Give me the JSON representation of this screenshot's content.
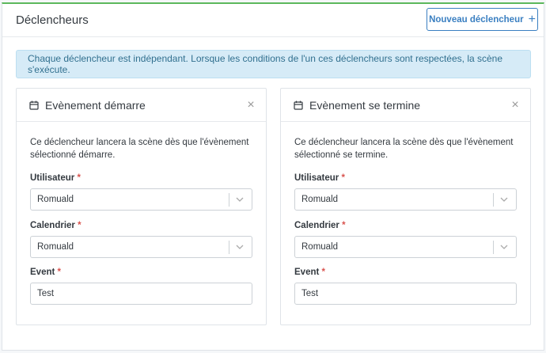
{
  "panel": {
    "title": "Déclencheurs",
    "new_button_label": "Nouveau déclencheur",
    "plus_glyph": "+",
    "info": "Chaque déclencheur est indépendant. Lorsque les conditions de l'un ces déclencheurs sont respectées, la scène s'exécute."
  },
  "cards": [
    {
      "title": "Evènement démarre",
      "description": "Ce déclencheur lancera la scène dès que l'évènement sélectionné démarre.",
      "user_label": "Utilisateur",
      "user_value": "Romuald",
      "calendar_label": "Calendrier",
      "calendar_value": "Romuald",
      "event_label": "Event",
      "event_value": "Test"
    },
    {
      "title": "Evènement se termine",
      "description": "Ce déclencheur lancera la scène dès que l'évènement sélectionné se termine.",
      "user_label": "Utilisateur",
      "user_value": "Romuald",
      "calendar_label": "Calendrier",
      "calendar_value": "Romuald",
      "event_label": "Event",
      "event_value": "Test"
    }
  ],
  "required_mark": "*",
  "close_glyph": "×",
  "icons": {
    "card": "calendar-icon",
    "close": "close-icon",
    "select": "chevron-down-icon",
    "add": "plus-icon"
  },
  "colors": {
    "accent_top": "#5cb85c",
    "primary": "#3a7fc1",
    "info_bg": "#d6ebf7",
    "required": "#d9534f"
  }
}
